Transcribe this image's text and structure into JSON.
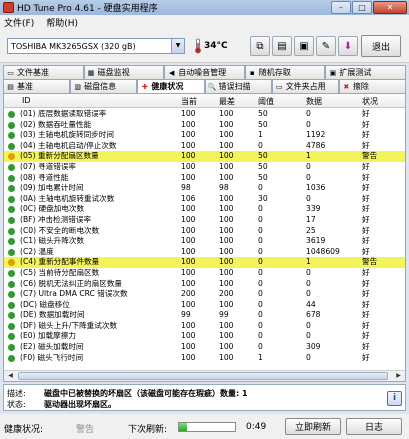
{
  "window": {
    "title": "HD Tune Pro 4.61 - 硬盘实用程序",
    "minimize": "–",
    "maximize": "□",
    "close": "✕"
  },
  "menu": [
    {
      "label": "文件(F)"
    },
    {
      "label": "帮助(H)"
    }
  ],
  "toolbar": {
    "drive": "TOSHIBA MK3265GSX (320 gB)",
    "temperature": "34°C",
    "exit_label": "退出"
  },
  "tabs_top": [
    {
      "label": "文件基准",
      "icon": "folder-icon"
    },
    {
      "label": "磁盘监视",
      "icon": "monitor-icon"
    },
    {
      "label": "自动噪音管理",
      "icon": "speaker-icon"
    },
    {
      "label": "随机存取",
      "icon": "random-icon"
    },
    {
      "label": "扩展测试",
      "icon": "extra-icon"
    }
  ],
  "tabs_bottom": [
    {
      "label": "基准",
      "icon": "benchmark-icon",
      "active": false
    },
    {
      "label": "磁盘信息",
      "icon": "info-icon",
      "active": false
    },
    {
      "label": "健康状况",
      "icon": "health-icon",
      "active": true
    },
    {
      "label": "错误扫描",
      "icon": "scan-icon",
      "active": false
    },
    {
      "label": "文件夹占用",
      "icon": "folder-usage-icon",
      "active": false
    },
    {
      "label": "擦除",
      "icon": "erase-icon",
      "active": false
    }
  ],
  "table": {
    "headers": {
      "id": "ID",
      "current": "当前",
      "worst": "最差",
      "threshold": "阈值",
      "data": "数据",
      "status": "状况"
    },
    "rows": [
      {
        "id": "(01) 底层数据读取错误率",
        "current": "100",
        "worst": "100",
        "threshold": "50",
        "data": "0",
        "status": "好",
        "warn": false
      },
      {
        "id": "(02) 数据吞吐量性能",
        "current": "100",
        "worst": "100",
        "threshold": "50",
        "data": "0",
        "status": "好",
        "warn": false
      },
      {
        "id": "(03) 主轴电机旋转同步时间",
        "current": "100",
        "worst": "100",
        "threshold": "1",
        "data": "1192",
        "status": "好",
        "warn": false
      },
      {
        "id": "(04) 主轴电机启动/停止次数",
        "current": "100",
        "worst": "100",
        "threshold": "0",
        "data": "4786",
        "status": "好",
        "warn": false
      },
      {
        "id": "(05) 重新分配扇区数量",
        "current": "100",
        "worst": "100",
        "threshold": "50",
        "data": "1",
        "status": "警告",
        "warn": true
      },
      {
        "id": "(07) 寻道错误率",
        "current": "100",
        "worst": "100",
        "threshold": "50",
        "data": "0",
        "status": "好",
        "warn": false
      },
      {
        "id": "(08) 寻道性能",
        "current": "100",
        "worst": "100",
        "threshold": "50",
        "data": "0",
        "status": "好",
        "warn": false
      },
      {
        "id": "(09) 加电累计时间",
        "current": "98",
        "worst": "98",
        "threshold": "0",
        "data": "1036",
        "status": "好",
        "warn": false
      },
      {
        "id": "(0A) 主轴电机旋转重试次数",
        "current": "106",
        "worst": "100",
        "threshold": "30",
        "data": "0",
        "status": "好",
        "warn": false
      },
      {
        "id": "(0C) 硬盘加电次数",
        "current": "100",
        "worst": "100",
        "threshold": "0",
        "data": "339",
        "status": "好",
        "warn": false
      },
      {
        "id": "(BF) 冲击检测错误率",
        "current": "100",
        "worst": "100",
        "threshold": "0",
        "data": "17",
        "status": "好",
        "warn": false
      },
      {
        "id": "(C0) 不安全的断电次数",
        "current": "100",
        "worst": "100",
        "threshold": "0",
        "data": "25",
        "status": "好",
        "warn": false
      },
      {
        "id": "(C1) 磁头升降次数",
        "current": "100",
        "worst": "100",
        "threshold": "0",
        "data": "3619",
        "status": "好",
        "warn": false
      },
      {
        "id": "(C2) 温度",
        "current": "100",
        "worst": "100",
        "threshold": "0",
        "data": "1048609",
        "status": "好",
        "warn": false
      },
      {
        "id": "(C4) 重新分配事件数量",
        "current": "100",
        "worst": "100",
        "threshold": "0",
        "data": "1",
        "status": "警告",
        "warn": true
      },
      {
        "id": "(C5) 当前待分配扇区数",
        "current": "100",
        "worst": "100",
        "threshold": "0",
        "data": "0",
        "status": "好",
        "warn": false
      },
      {
        "id": "(C6) 脱机无法纠正的扇区数量",
        "current": "100",
        "worst": "100",
        "threshold": "0",
        "data": "0",
        "status": "好",
        "warn": false
      },
      {
        "id": "(C7) Ultra DMA CRC 错误次数",
        "current": "200",
        "worst": "200",
        "threshold": "0",
        "data": "0",
        "status": "好",
        "warn": false
      },
      {
        "id": "(DC) 磁盘移位",
        "current": "100",
        "worst": "100",
        "threshold": "0",
        "data": "44",
        "status": "好",
        "warn": false
      },
      {
        "id": "(DE) 数据加载时间",
        "current": "99",
        "worst": "99",
        "threshold": "0",
        "data": "678",
        "status": "好",
        "warn": false
      },
      {
        "id": "(DF) 磁头上升/下降重试次数",
        "current": "100",
        "worst": "100",
        "threshold": "0",
        "data": "0",
        "status": "好",
        "warn": false
      },
      {
        "id": "(E0) 加载摩擦力",
        "current": "100",
        "worst": "100",
        "threshold": "0",
        "data": "0",
        "status": "好",
        "warn": false
      },
      {
        "id": "(E2) 磁头加载时间",
        "current": "100",
        "worst": "100",
        "threshold": "0",
        "data": "309",
        "status": "好",
        "warn": false
      },
      {
        "id": "(F0) 磁头飞行时间",
        "current": "100",
        "worst": "100",
        "threshold": "1",
        "data": "0",
        "status": "好",
        "warn": false
      }
    ]
  },
  "description": {
    "label": "描述:",
    "value": "磁盘中已被替换的坏扇区（该磁盘可能存在瑕疵）数量: 1",
    "status_label": "状态:",
    "status_value": "驱动器出现坏扇区。"
  },
  "statusbar": {
    "health_label": "健康状况:",
    "health_value": "警告",
    "next_refresh_label": "下次刷新:",
    "progress_percent": 15,
    "time": "0:49",
    "refresh_btn": "立即刷新",
    "log_btn": "日志"
  }
}
